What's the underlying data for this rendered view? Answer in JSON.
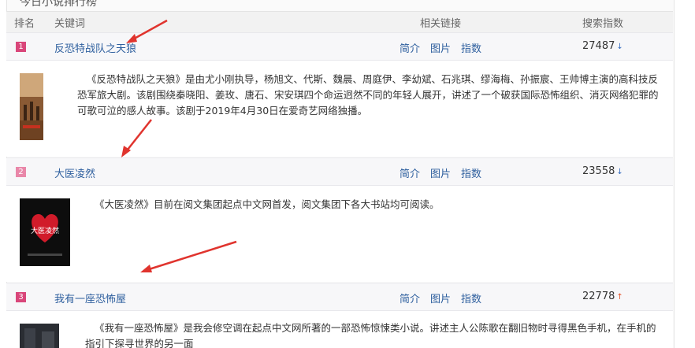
{
  "panel": {
    "title": "今日小说排行榜"
  },
  "header": {
    "rank": "排名",
    "keyword": "关键词",
    "links": "相关链接",
    "index": "搜索指数"
  },
  "rows": [
    {
      "rank": "1",
      "keyword": "反恐特战队之天狼",
      "links": [
        "简介",
        "图片",
        "指数"
      ],
      "index": "27487",
      "trend": "down",
      "description": "《反恐特战队之天狼》是由尤小刚执导，杨旭文、代斯、魏晨、周庭伊、李幼斌、石兆琪、缪海梅、孙振宸、王帅博主演的高科技反恐军旅大剧。该剧围绕秦晓阳、姜玫、唐石、宋安琪四个命运迥然不同的年轻人展开，讲述了一个破获国际恐怖组织、消灭网络犯罪的可歌可泣的感人故事。该剧于2019年4月30日在爱奇艺网络独播。"
    },
    {
      "rank": "2",
      "keyword": "大医凌然",
      "links": [
        "简介",
        "图片",
        "指数"
      ],
      "index": "23558",
      "trend": "down",
      "cover_text": "大医凌然",
      "description": "《大医凌然》目前在阅文集团起点中文网首发，阅文集团下各大书站均可阅读。"
    },
    {
      "rank": "3",
      "keyword": "我有一座恐怖屋",
      "links": [
        "简介",
        "图片",
        "指数"
      ],
      "index": "22778",
      "trend": "up",
      "description": "《我有一座恐怖屋》是我会修空调在起点中文网所著的一部恐怖惊悚类小说。讲述主人公陈歌在翻旧物时寻得黑色手机，在手机的指引下探寻世界的另一面"
    }
  ],
  "colors": {
    "rank_badge": "#d9467a",
    "link": "#2e5f9e",
    "arrow": "#e0342e",
    "trend_up": "#e4532b",
    "trend_down": "#3a6fc0"
  },
  "icons": {
    "trend_down": "arrow-down-icon",
    "trend_up": "arrow-up-icon"
  }
}
